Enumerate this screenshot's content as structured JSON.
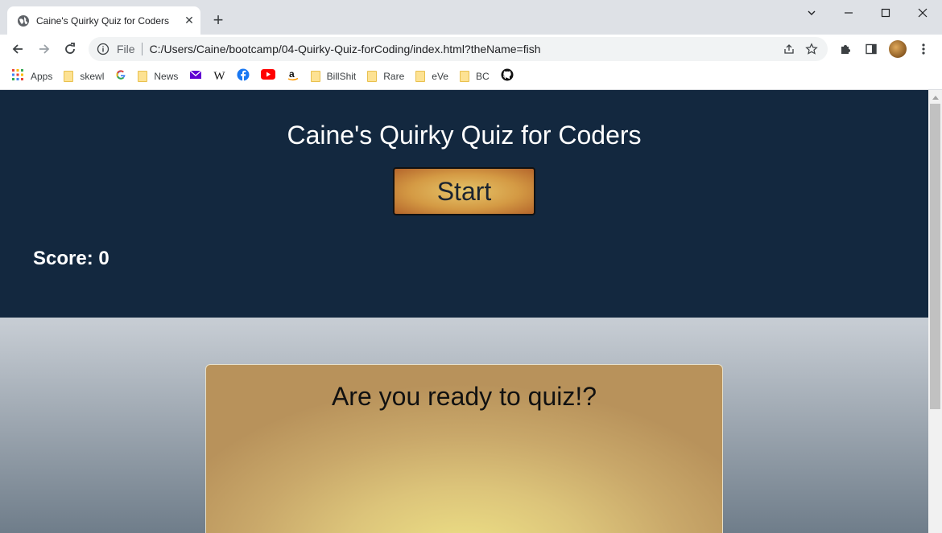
{
  "browser": {
    "tab": {
      "title": "Caine's Quirky Quiz for Coders"
    },
    "address": {
      "scheme_label": "File",
      "url": "C:/Users/Caine/bootcamp/04-Quirky-Quiz-forCoding/index.html?theName=fish"
    },
    "bookmarks": [
      {
        "label": "Apps",
        "icon": "apps-grid-icon"
      },
      {
        "label": "skewl",
        "icon": "folder-icon"
      },
      {
        "label": "",
        "icon": "google-icon"
      },
      {
        "label": "News",
        "icon": "folder-icon"
      },
      {
        "label": "",
        "icon": "mail-icon"
      },
      {
        "label": "",
        "icon": "wikipedia-icon"
      },
      {
        "label": "",
        "icon": "facebook-icon"
      },
      {
        "label": "",
        "icon": "youtube-icon"
      },
      {
        "label": "",
        "icon": "amazon-icon"
      },
      {
        "label": "BillShit",
        "icon": "folder-icon"
      },
      {
        "label": "Rare",
        "icon": "folder-icon"
      },
      {
        "label": "eVe",
        "icon": "folder-icon"
      },
      {
        "label": "BC",
        "icon": "folder-icon"
      },
      {
        "label": "",
        "icon": "github-icon"
      }
    ]
  },
  "page": {
    "title": "Caine's Quirky Quiz for Coders",
    "start_label": "Start",
    "score_text": "Score: 0",
    "quiz_prompt": "Are you ready to quiz!?"
  },
  "colors": {
    "header_bg": "#13283f",
    "start_button": "#d49a44",
    "card_gold": "#dcc47a"
  }
}
